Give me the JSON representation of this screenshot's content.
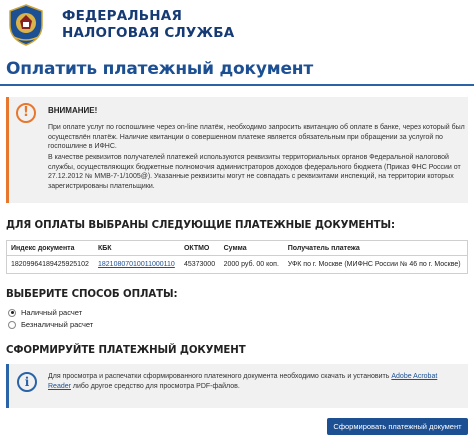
{
  "header": {
    "agency_line1": "ФЕДЕРАЛЬНАЯ",
    "agency_line2": "НАЛОГОВАЯ СЛУЖБА"
  },
  "page_title": "Оплатить платежный документ",
  "warning": {
    "icon": "exclamation-icon",
    "title": "ВНИМАНИЕ!",
    "paragraph1": "При оплате услуг по госпошлине через on-line платёж, необходимо запросить квитанцию об оплате в банке, через который был осуществлён платёж. Наличие квитанции о совершенном платеже является обязательным при обращении за услугой по госпошлине в ИФНС.",
    "paragraph2": "В качестве реквизитов получателей платежей используются реквизиты территориальных органов Федеральной налоговой службы, осуществляющих бюджетные полномочия администраторов доходов федерального бюджета (Приказ ФНС России от 27.12.2012 № ММВ-7-1/1005@). Указанные реквизиты могут не совпадать с реквизитами инспекций, на территории которых зарегистрированы плательщики."
  },
  "docs_section": {
    "heading": "ДЛЯ ОПЛАТЫ ВЫБРАНЫ СЛЕДУЮЩИЕ ПЛАТЕЖНЫЕ ДОКУМЕНТЫ:",
    "columns": [
      "Индекс документа",
      "КБК",
      "ОКТМО",
      "Сумма",
      "Получатель платежа"
    ],
    "rows": [
      {
        "index": "18209964189425925102",
        "kbk": "18210807010011000110",
        "oktmo": "45373000",
        "sum": "2000 руб. 00 коп.",
        "recipient": "УФК по г. Москве (МИФНС России № 46 по г. Москве)"
      }
    ]
  },
  "payment_method": {
    "heading": "ВЫБЕРИТЕ СПОСОБ ОПЛАТЫ:",
    "options": [
      {
        "label": "Наличный расчет",
        "selected": true
      },
      {
        "label": "Безналичный расчет",
        "selected": false
      }
    ]
  },
  "form_section": {
    "heading": "СФОРМИРУЙТЕ ПЛАТЕЖНЫЙ ДОКУМЕНТ",
    "info_icon": "info-icon",
    "info_before": "Для просмотра и распечатки сформированного платежного документа необходимо скачать и установить ",
    "info_link": "Adobe Acrobat Reader",
    "info_after": " либо другое средство для просмотра PDF-файлов."
  },
  "submit_label": "Сформировать платежный документ",
  "colors": {
    "brand_blue": "#1d4f93",
    "warning_orange": "#e8772e",
    "panel_gray": "#f1f1f1"
  }
}
